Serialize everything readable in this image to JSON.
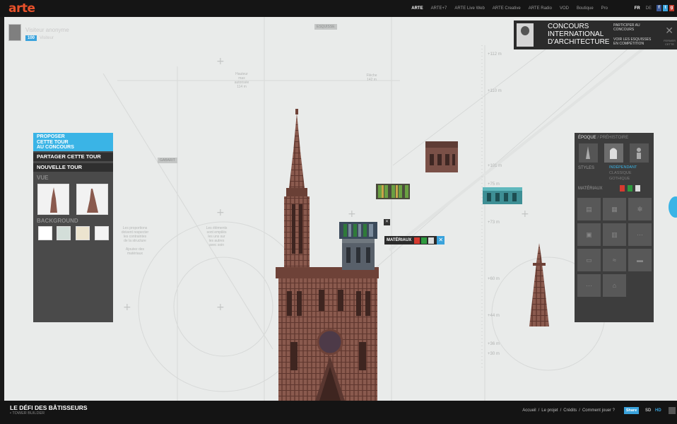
{
  "topbar": {
    "logo": "arte",
    "nav": [
      "ARTE",
      "ARTE+7",
      "ARTE Live Web",
      "ARTE Creative",
      "ARTE Radio",
      "VOD",
      "Boutique",
      "Pro"
    ],
    "langs": [
      "FR",
      "DE"
    ],
    "social": [
      "f",
      "t",
      "g"
    ]
  },
  "user": {
    "name": "Visiteur anonyme",
    "badge": "100",
    "status": "Visiteur"
  },
  "guides": {
    "tag_top": "ESQUISSE",
    "tag_left": "GABARIT",
    "note1": "Hauteur\nmax\nautorisée\n114 m",
    "note2": "Flèche\n142 m",
    "note3": "Les proportions\ndoivent respecter\nles contraintes\nde la structure",
    "note4": "Les éléments\nsont empilés\nles uns sur\nles autres\navec soin",
    "note5": "Ajoutez des\nmatériaux",
    "rulers": [
      "+112 m",
      "+110 m",
      "+101 m",
      "+75 m",
      "+73 m",
      "+60 m",
      "+44 m",
      "+36 m",
      "+30 m"
    ]
  },
  "banner": {
    "title_1": "CONCOURS",
    "title_2": "INTERNATIONAL",
    "title_3": "D'ARCHITECTURE",
    "link1_1": "PARTICIPER AU",
    "link1_2": "CONCOURS",
    "link2_1": "VOIR LES ESQUISSES",
    "link2_2": "EN COMPÉTITION",
    "close_1": "FERMER",
    "close_2": "CETTE"
  },
  "left_panel": {
    "propose_1": "PROPOSER",
    "propose_2": "CETTE TOUR",
    "propose_3": "AU CONCOURS",
    "share": "PARTAGER CETTE TOUR",
    "new": "NOUVELLE TOUR",
    "view_label": "VUE",
    "background_label": "BACKGROUND",
    "bg_colors": [
      "#ffffff",
      "#d3ded9",
      "#ece4cf",
      "#f3f3f3"
    ]
  },
  "right_panel": {
    "tab_epoque": "ÉPOQUE",
    "tab_prehistoire": "/ PRÉHISTOIRE",
    "styles_label": "STYLES",
    "styles": [
      "INDÉPENDANT",
      "CLASSIQUE",
      "GOTHIQUE"
    ],
    "materials_label": "MATÉRIAUX",
    "material_colors": [
      "#d63a2f",
      "#2f9a3f",
      "#dddddd"
    ]
  },
  "materials_bar": {
    "label": "MATÉRIAUX",
    "colors": [
      "#d63a2f",
      "#2f9a3f",
      "#dddddd"
    ],
    "close": "✕"
  },
  "bottombar": {
    "title": "LE DÉFI DES BÂTISSEURS",
    "subtitle": "• TOWER BUILDER",
    "links": [
      "Accueil",
      "/",
      "Le projet",
      "/",
      "Crédits",
      "/",
      "Comment jouer ?"
    ],
    "share": "Share",
    "sd": "SD",
    "hd": "HD"
  }
}
